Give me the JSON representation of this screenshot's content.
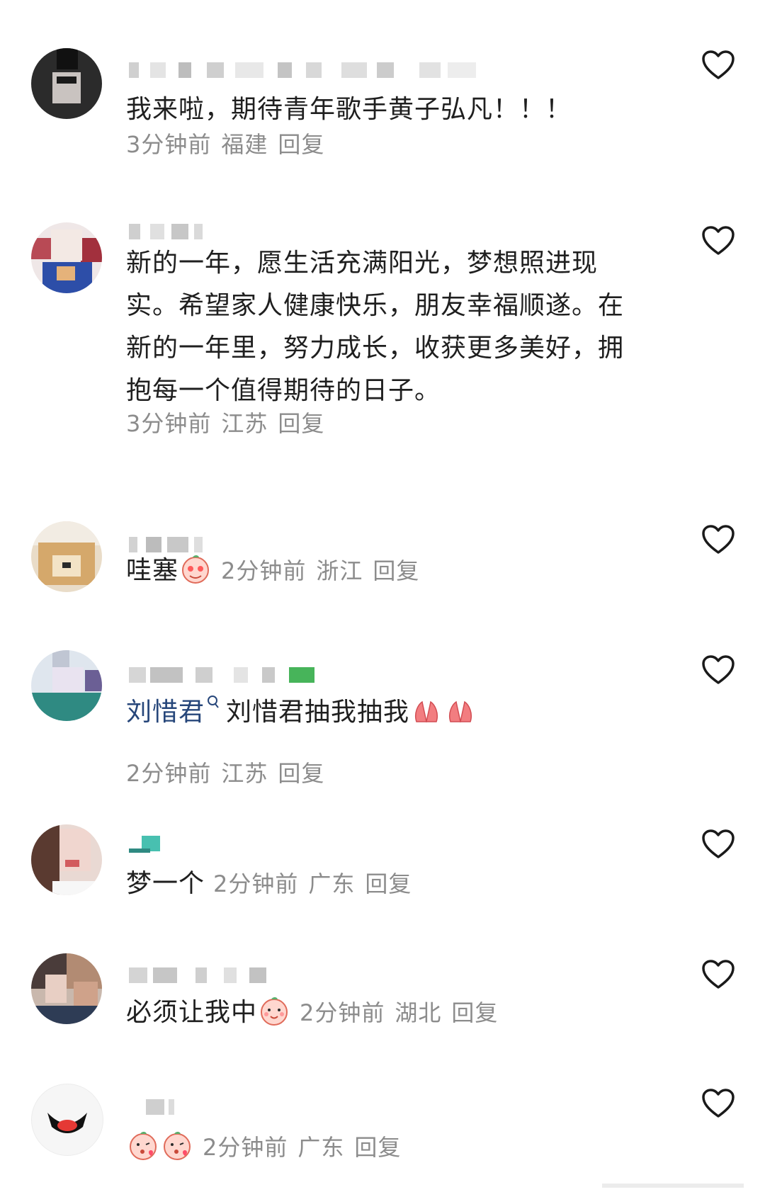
{
  "comments": [
    {
      "text": "我来啦，期待青年歌手黄子弘凡！！！",
      "time": "3分钟前",
      "location": "福建",
      "reply": "回复"
    },
    {
      "text": "新的一年，愿生活充满阳光，梦想照进现实。希望家人健康快乐，朋友幸福顺遂。在新的一年里，努力成长，收获更多美好，拥抱每一个值得期待的日子。",
      "time": "3分钟前",
      "location": "江苏",
      "reply": "回复"
    },
    {
      "text": "哇塞",
      "time": "2分钟前",
      "location": "浙江",
      "reply": "回复"
    },
    {
      "mention": "刘惜君",
      "text": "刘惜君抽我抽我",
      "time": "2分钟前",
      "location": "江苏",
      "reply": "回复"
    },
    {
      "text": "梦一个",
      "time": "2分钟前",
      "location": "广东",
      "reply": "回复"
    },
    {
      "text": "必须让我中",
      "time": "2分钟前",
      "location": "湖北",
      "reply": "回复"
    },
    {
      "text": "",
      "time": "2分钟前",
      "location": "广东",
      "reply": "回复"
    }
  ],
  "icons": {
    "like": "heart-outline-icon",
    "search": "search-icon"
  },
  "colors": {
    "text": "#1f1f1f",
    "meta": "#8c8c8c",
    "mention": "#26467a",
    "heart": "#1a1a1a"
  }
}
